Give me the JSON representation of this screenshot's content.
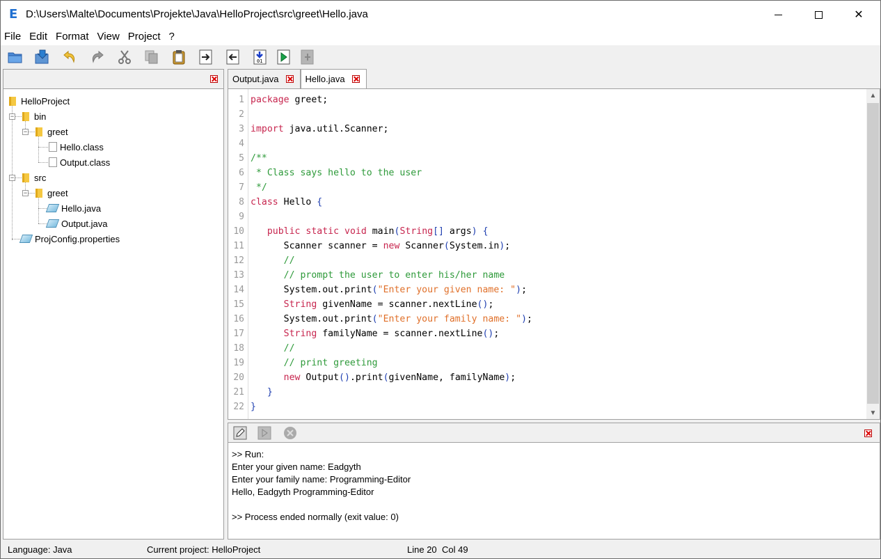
{
  "window": {
    "title": "D:\\Users\\Malte\\Documents\\Projekte\\Java\\HelloProject\\src\\greet\\Hello.java",
    "logo": "E",
    "minimize_label": "minimize",
    "maximize_label": "maximize",
    "close_glyph": "✕"
  },
  "menu": [
    "File",
    "Edit",
    "Format",
    "View",
    "Project",
    "?"
  ],
  "toolbar": {
    "buttons": [
      "open-icon",
      "save-icon",
      "undo-icon",
      "redo-icon",
      "cut-icon",
      "copy-icon",
      "paste-icon",
      "indent-icon",
      "outdent-icon",
      "compile-icon",
      "run-icon",
      "run-disabled-icon"
    ]
  },
  "tree": {
    "root": "HelloProject",
    "bin": "bin",
    "bin_greet": "greet",
    "hello_class": "Hello.class",
    "output_class": "Output.class",
    "src": "src",
    "src_greet": "greet",
    "hello_java": "Hello.java",
    "output_java": "Output.java",
    "projconfig": "ProjConfig.properties"
  },
  "tabs": {
    "tab1": "Output.java",
    "tab2": "Hello.java",
    "active": "Hello.java"
  },
  "code": {
    "line_numbers": [
      "1",
      "2",
      "3",
      "4",
      "5",
      "6",
      "7",
      "8",
      "9",
      "10",
      "11",
      "12",
      "13",
      "14",
      "15",
      "16",
      "17",
      "18",
      "19",
      "20",
      "21",
      "22"
    ],
    "lines": [
      "package greet;",
      "",
      "import java.util.Scanner;",
      "",
      "/**",
      " * Class says hello to the user",
      " */",
      "class Hello {",
      "",
      "   public static void main(String[] args) {",
      "      Scanner scanner = new Scanner(System.in);",
      "      //",
      "      // prompt the user to enter his/her name",
      "      System.out.print(\"Enter your given name: \");",
      "      String givenName = scanner.nextLine();",
      "      System.out.print(\"Enter your family name: \");",
      "      String familyName = scanner.nextLine();",
      "      //",
      "      // print greeting",
      "      new Output().print(givenName, familyName);",
      "   }",
      "}"
    ]
  },
  "console": {
    "lines": [
      ">> Run:",
      "Enter your given name: Eadgyth",
      "Enter your family name: Programming-Editor",
      "Hello, Eadgyth Programming-Editor",
      "",
      ">> Process ended normally (exit value: 0)"
    ]
  },
  "status": {
    "language": "Language: Java",
    "project": "Current project: HelloProject",
    "line": "Line 20",
    "col": "Col 49"
  },
  "colors": {
    "keyword": "#c7254e",
    "comment": "#2e9a3a",
    "string": "#e0702a",
    "bracket": "#1f3fb0",
    "close": "#d00000"
  }
}
